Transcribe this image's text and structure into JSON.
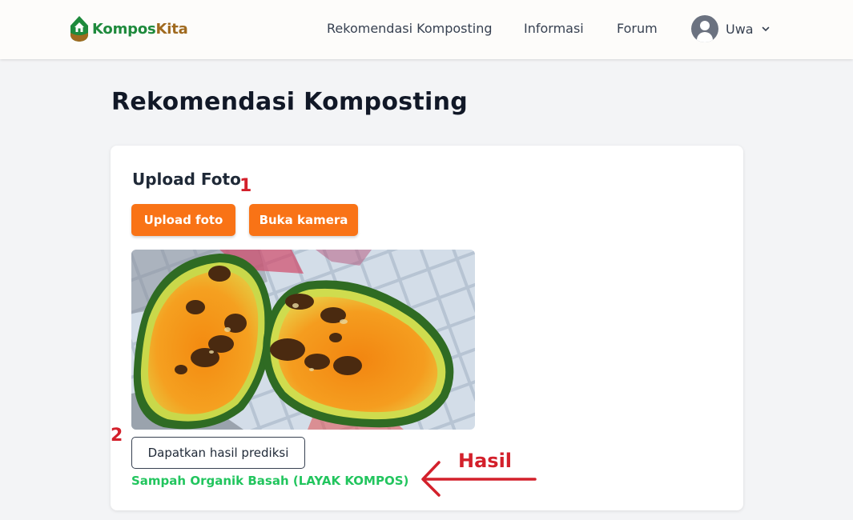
{
  "navbar": {
    "logo_part1": "Kompos",
    "logo_part2": "Kita",
    "links": [
      "Rekomendasi Komposting",
      "Informasi",
      "Forum"
    ],
    "user_name": "Uwa",
    "logo_colors": {
      "green": "#1e8a3c",
      "brown": "#a06a1f"
    }
  },
  "page": {
    "title": "Rekomendasi Komposting"
  },
  "upload": {
    "title": "Upload Foto",
    "upload_button": "Upload foto",
    "camera_button": "Buka kamera",
    "predict_button": "Dapatkan hasil prediksi",
    "result": "Sampah Organik Basah (LAYAK KOMPOS)"
  },
  "annotations": {
    "step1": "1",
    "step2": "2",
    "result_label": "Hasil"
  },
  "colors": {
    "accent": "#f97316",
    "result": "#22c55e",
    "annotation": "#d3202b"
  },
  "icons": [
    "logo-house-icon",
    "user-avatar-icon",
    "chevron-down-icon",
    "annotation-arrow-left-icon"
  ]
}
